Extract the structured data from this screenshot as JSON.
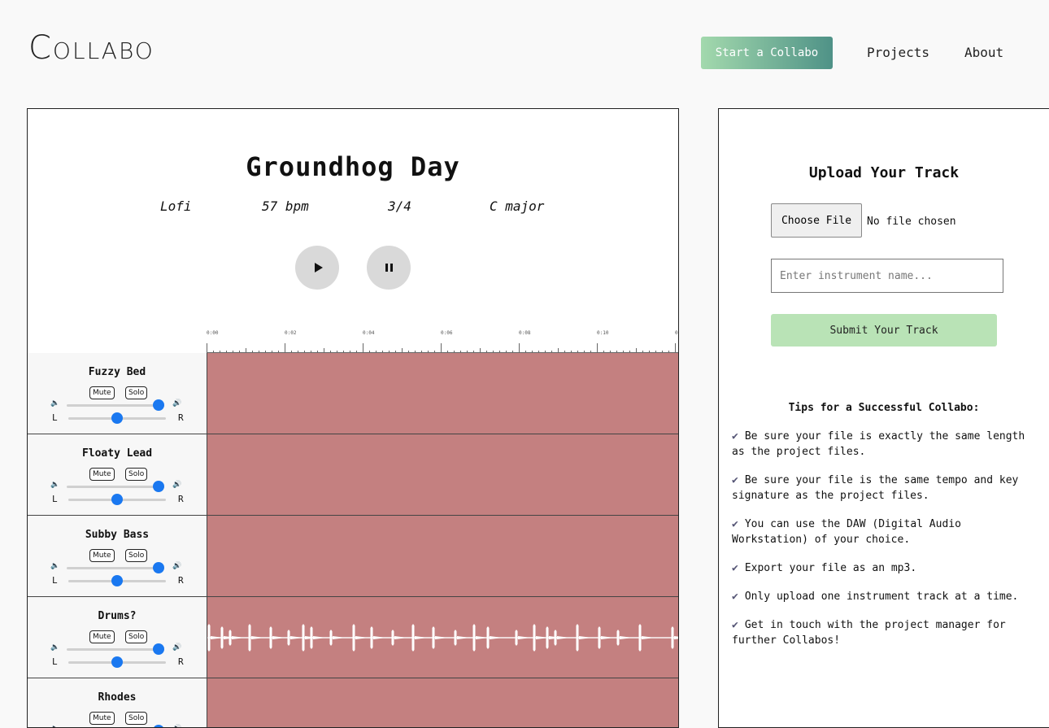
{
  "header": {
    "logo": "Collabo",
    "cta_label": "Start a Collabo",
    "nav": [
      "Projects",
      "About"
    ]
  },
  "project": {
    "title": "Groundhog Day",
    "genre": "Lofi",
    "tempo": "57 bpm",
    "time_signature": "3/4",
    "key": "C major"
  },
  "timeline": {
    "labels": [
      "0:00",
      "0:02",
      "0:04",
      "0:06",
      "0:08",
      "0:10",
      "0"
    ]
  },
  "tracks": [
    {
      "name": "Fuzzy Bed",
      "mute_label": "Mute",
      "solo_label": "Solo",
      "has_waveform": false
    },
    {
      "name": "Floaty Lead",
      "mute_label": "Mute",
      "solo_label": "Solo",
      "has_waveform": false
    },
    {
      "name": "Subby Bass",
      "mute_label": "Mute",
      "solo_label": "Solo",
      "has_waveform": false
    },
    {
      "name": "Drums?",
      "mute_label": "Mute",
      "solo_label": "Solo",
      "has_waveform": true
    },
    {
      "name": "Rhodes",
      "mute_label": "Mute",
      "solo_label": "Solo",
      "has_waveform": false
    }
  ],
  "pan_labels": {
    "left": "L",
    "right": "R"
  },
  "upload": {
    "title": "Upload Your Track",
    "choose_file_label": "Choose File",
    "no_file_text": "No file chosen",
    "instrument_placeholder": "Enter instrument name...",
    "submit_label": "Submit Your Track"
  },
  "tips": {
    "title": "Tips for a Successful Collabo:",
    "items": [
      "Be sure your file is exactly the same length as the project files.",
      "Be sure your file is the same tempo and key signature as the project files.",
      "You can use the DAW (Digital Audio Workstation) of your choice.",
      "Export your file as an mp3.",
      "Only upload one instrument track at a time.",
      "Get in touch with the project manager for further Collabos!"
    ]
  },
  "colors": {
    "track_bg": "#c48080",
    "slider_thumb": "#1a78f0",
    "submit_bg": "#b9e3b6",
    "cta_gradient_start": "#a3d9ad",
    "cta_gradient_end": "#4f9287",
    "check": "#555575"
  }
}
